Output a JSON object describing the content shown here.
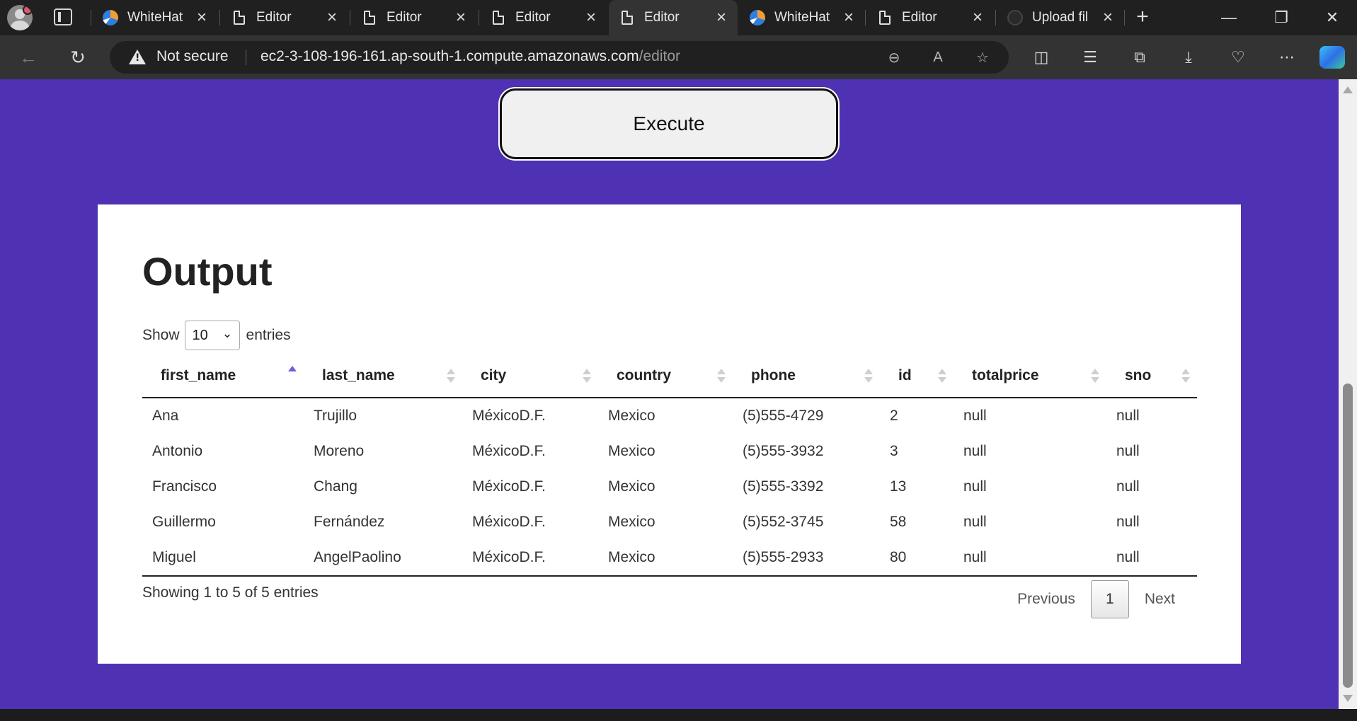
{
  "browser": {
    "tabs": [
      {
        "label": "WhiteHat",
        "icon": "whitehat-favicon-icon"
      },
      {
        "label": "Editor",
        "icon": "document-icon"
      },
      {
        "label": "Editor",
        "icon": "document-icon"
      },
      {
        "label": "Editor",
        "icon": "document-icon"
      },
      {
        "label": "Editor",
        "icon": "document-icon",
        "active": true
      },
      {
        "label": "WhiteHat",
        "icon": "whitehat-favicon-icon"
      },
      {
        "label": "Editor",
        "icon": "document-icon"
      },
      {
        "label": "Upload fil",
        "icon": "github-icon"
      }
    ],
    "security_label": "Not secure",
    "url_host": "ec2-3-108-196-161.ap-south-1.compute.amazonaws.com",
    "url_path": "/editor"
  },
  "page": {
    "execute_label": "Execute",
    "output_title": "Output",
    "length_menu": {
      "prefix": "Show",
      "value": "10",
      "suffix": "entries"
    },
    "table": {
      "columns": [
        "first_name",
        "last_name",
        "city",
        "country",
        "phone",
        "id",
        "totalprice",
        "sno"
      ],
      "sorted_column": "first_name",
      "sort_direction": "ascending",
      "rows": [
        [
          "Ana",
          "Trujillo",
          "MéxicoD.F.",
          "Mexico",
          "(5)555-4729",
          "2",
          "null",
          "null"
        ],
        [
          "Antonio",
          "Moreno",
          "MéxicoD.F.",
          "Mexico",
          "(5)555-3932",
          "3",
          "null",
          "null"
        ],
        [
          "Francisco",
          "Chang",
          "MéxicoD.F.",
          "Mexico",
          "(5)555-3392",
          "13",
          "null",
          "null"
        ],
        [
          "Guillermo",
          "Fernández",
          "MéxicoD.F.",
          "Mexico",
          "(5)552-3745",
          "58",
          "null",
          "null"
        ],
        [
          "Miguel",
          "AngelPaolino",
          "MéxicoD.F.",
          "Mexico",
          "(5)555-2933",
          "80",
          "null",
          "null"
        ]
      ]
    },
    "info_text": "Showing 1 to 5 of 5 entries",
    "pagination": {
      "previous": "Previous",
      "current": "1",
      "next": "Next"
    }
  },
  "colors": {
    "page_background": "#4f31b3",
    "sort_active": "#6d5fd8",
    "browser_chrome": "#202020"
  }
}
